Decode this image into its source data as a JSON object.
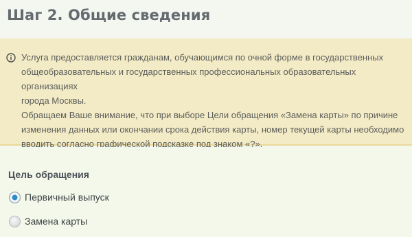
{
  "header": {
    "title": "Шаг 2. Общие сведения"
  },
  "notice": {
    "icon": "info-icon",
    "paragraph_1": "Услуга предоставляется гражданам, обучающимся по очной форме в государственных\nобщеобразовательных и государственных профессиональных образовательных организациях\nгорода Москвы.",
    "paragraph_2": "Обращаем Ваше внимание, что при выборе Цели обращения «Замена карты» по причине\nизменения данных или окончании срока действия карты, номер текущей карты необходимо\nвводить согласно графической подсказке под знаком «?»."
  },
  "form": {
    "purpose_label": "Цель обращения",
    "options": [
      {
        "label": "Первичный выпуск",
        "checked": true
      },
      {
        "label": "Замена карты",
        "checked": false
      }
    ]
  },
  "colors": {
    "title_text": "#646a70",
    "notice_background": "#f3ebc6",
    "notice_border": "#ead89a",
    "form_background": "#f3f8ea",
    "radio_selected": "#2e8bc7"
  }
}
